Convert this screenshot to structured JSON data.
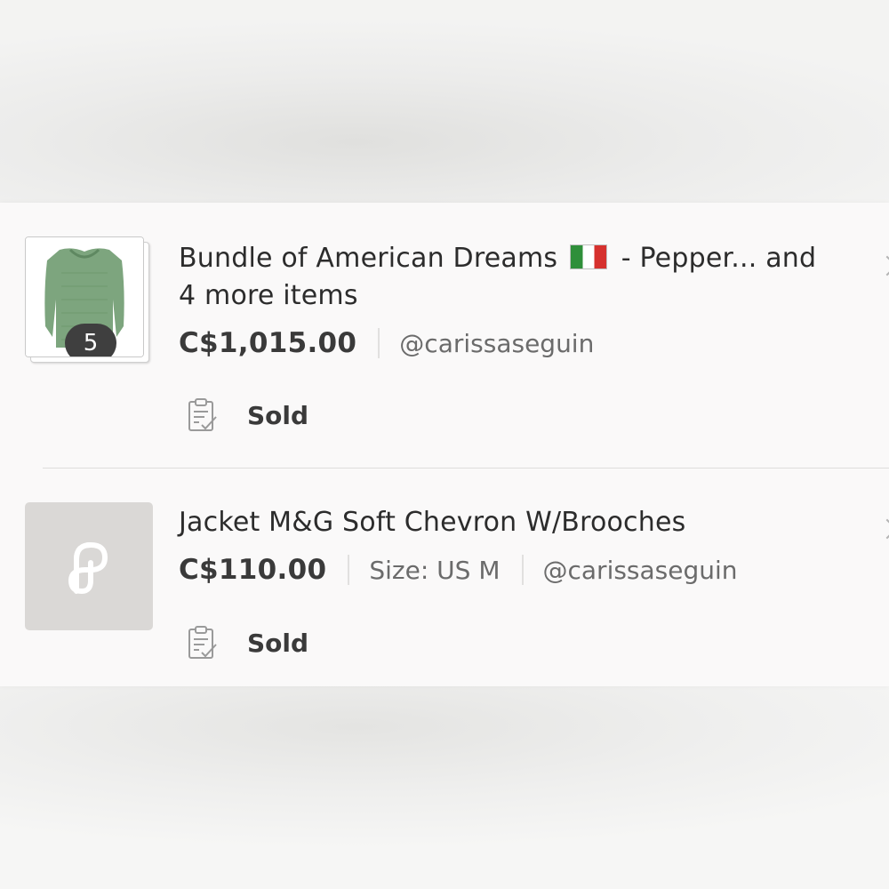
{
  "orders": [
    {
      "title_line1_a": "Bundle of American Dreams",
      "flag_icon": "italy-flag-icon",
      "title_line1_b": "-  Pepper... and",
      "title_line2": "4 more items",
      "item_count": "5",
      "price": "C$1,015.00",
      "seller": "@carissaseguin",
      "status": "Sold"
    },
    {
      "title": "Jacket M&G Soft Chevron W/Brooches",
      "price": "C$110.00",
      "size": "Size: US M",
      "seller": "@carissaseguin",
      "status": "Sold"
    }
  ],
  "colors": {
    "panel_bg": "#faf9f9",
    "badge_bg": "#3f3f3f",
    "placeholder_bg": "#dad8d6",
    "sweater_green": "#7da57e"
  }
}
